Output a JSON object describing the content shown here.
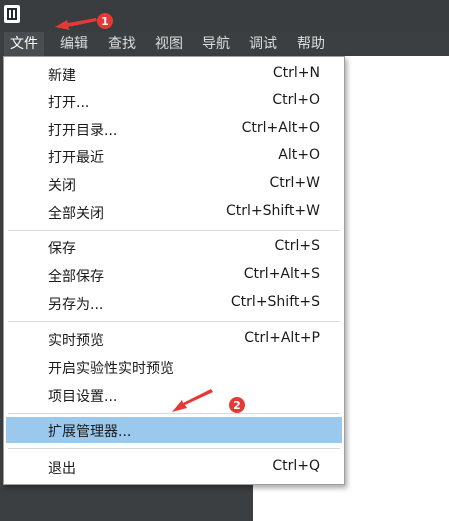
{
  "menubar": {
    "items": [
      {
        "label": "文件"
      },
      {
        "label": "编辑"
      },
      {
        "label": "查找"
      },
      {
        "label": "视图"
      },
      {
        "label": "导航"
      },
      {
        "label": "调试"
      },
      {
        "label": "帮助"
      }
    ]
  },
  "file_menu": {
    "items": [
      {
        "label": "新建",
        "shortcut": "Ctrl+N"
      },
      {
        "label": "打开...",
        "shortcut": "Ctrl+O"
      },
      {
        "label": "打开目录...",
        "shortcut": "Ctrl+Alt+O"
      },
      {
        "label": "打开最近",
        "shortcut": "Alt+O"
      },
      {
        "label": "关闭",
        "shortcut": "Ctrl+W"
      },
      {
        "label": "全部关闭",
        "shortcut": "Ctrl+Shift+W"
      },
      {
        "label": "保存",
        "shortcut": "Ctrl+S"
      },
      {
        "label": "全部保存",
        "shortcut": "Ctrl+Alt+S"
      },
      {
        "label": "另存为...",
        "shortcut": "Ctrl+Shift+S"
      },
      {
        "label": "实时预览",
        "shortcut": "Ctrl+Alt+P"
      },
      {
        "label": "开启实验性实时预览",
        "shortcut": ""
      },
      {
        "label": "项目设置...",
        "shortcut": ""
      },
      {
        "label": "扩展管理器...",
        "shortcut": ""
      },
      {
        "label": "退出",
        "shortcut": "Ctrl+Q"
      }
    ]
  },
  "annotations": {
    "step1": "1",
    "step2": "2"
  },
  "colors": {
    "highlight": "#9bc9ee",
    "arrow": "#e53935",
    "menubar_bg": "#3c3f41"
  }
}
